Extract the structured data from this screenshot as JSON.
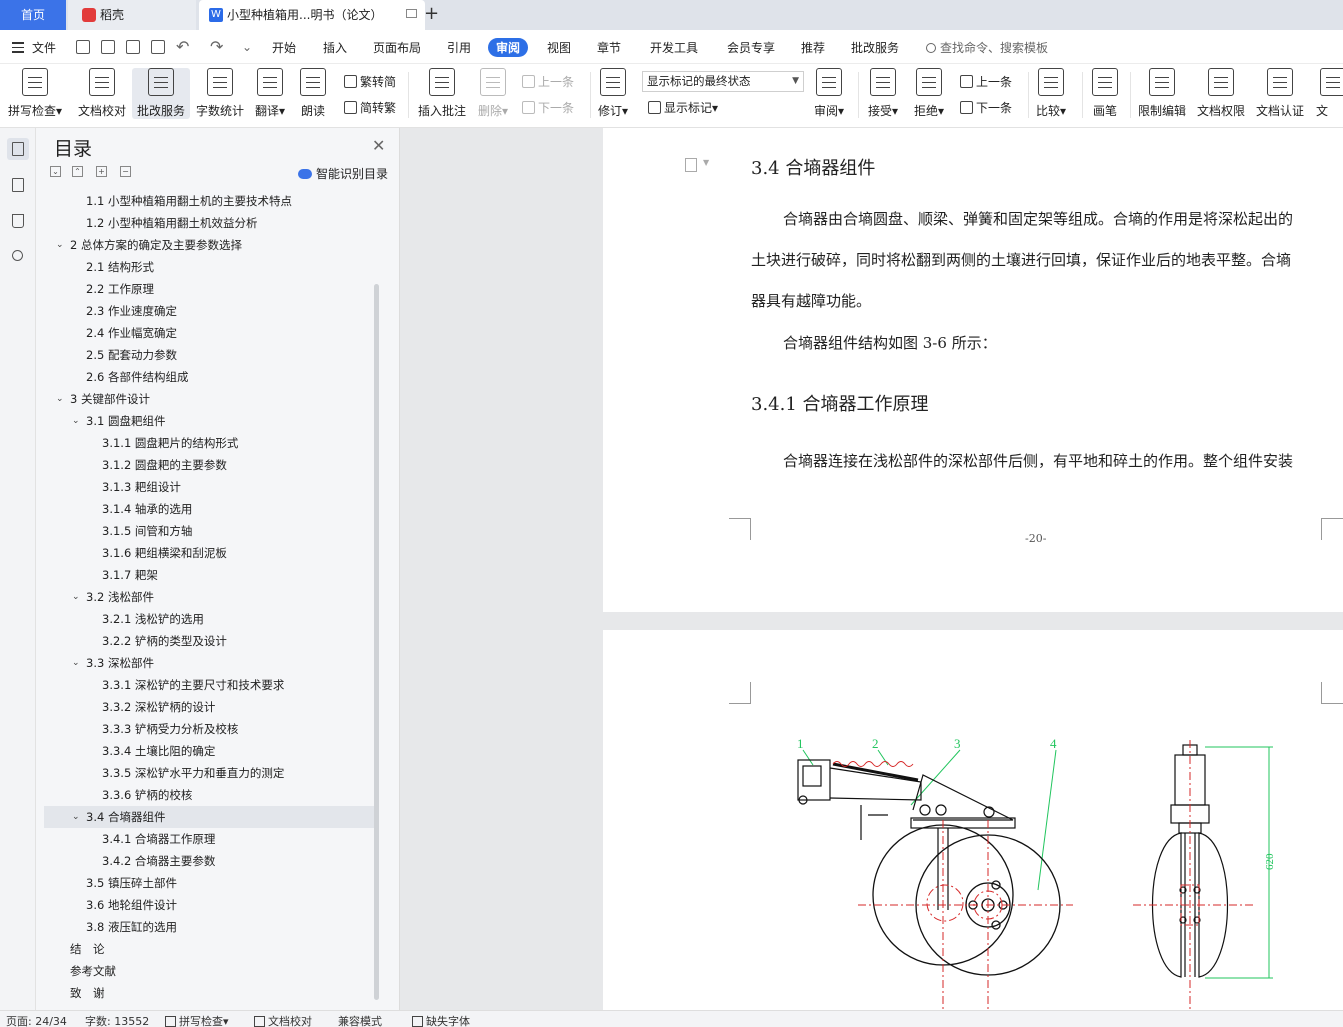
{
  "tabs": {
    "home": "首页",
    "daoke": "稻壳",
    "document": "小型种植箱用...明书（论文）",
    "doc_icon_letter": "W"
  },
  "menu": {
    "file": "文件",
    "items": [
      "开始",
      "插入",
      "页面布局",
      "引用",
      "审阅",
      "视图",
      "章节",
      "开发工具",
      "会员专享",
      "推荐",
      "批改服务"
    ],
    "active": "审阅",
    "search_placeholder": "查找命令、搜索模板"
  },
  "ribbon": {
    "spell_check": "拼写检查",
    "doc_proofread": "文档校对",
    "correction_service": "批改服务",
    "word_count": "字数统计",
    "translate": "翻译",
    "read_aloud": "朗读",
    "trad_to_simp": "繁转简",
    "simp_to_trad": "简转繁",
    "insert_comment": "插入批注",
    "delete": "删除",
    "prev_comment": "上一条",
    "next_comment": "下一条",
    "track_changes": "修订",
    "markup_select": "显示标记的最终状态",
    "show_markup": "显示标记",
    "review": "审阅",
    "accept": "接受",
    "reject": "拒绝",
    "prev_change": "上一条",
    "next_change": "下一条",
    "compare": "比较",
    "pen": "画笔",
    "restrict_edit": "限制编辑",
    "doc_permission": "文档权限",
    "doc_certify": "文档认证",
    "doc_cut": "文"
  },
  "toc": {
    "title": "目录",
    "smart_recognize": "智能识别目录",
    "items": [
      {
        "label": "1.1 小型种植箱用翻土机的主要技术特点",
        "level": 2,
        "expand": "none",
        "selected": false
      },
      {
        "label": "1.2 小型种植箱用翻土机效益分析",
        "level": 2,
        "expand": "none",
        "selected": false
      },
      {
        "label": "2 总体方案的确定及主要参数选择",
        "level": 1,
        "expand": "open",
        "selected": false
      },
      {
        "label": "2.1 结构形式",
        "level": 2,
        "expand": "none",
        "selected": false
      },
      {
        "label": "2.2 工作原理",
        "level": 2,
        "expand": "none",
        "selected": false
      },
      {
        "label": "2.3 作业速度确定",
        "level": 2,
        "expand": "none",
        "selected": false
      },
      {
        "label": "2.4 作业幅宽确定",
        "level": 2,
        "expand": "none",
        "selected": false
      },
      {
        "label": "2.5 配套动力参数",
        "level": 2,
        "expand": "none",
        "selected": false
      },
      {
        "label": "2.6 各部件结构组成",
        "level": 2,
        "expand": "none",
        "selected": false
      },
      {
        "label": "3 关键部件设计",
        "level": 1,
        "expand": "open",
        "selected": false
      },
      {
        "label": "3.1 圆盘耙组件",
        "level": 2,
        "expand": "open",
        "selected": false
      },
      {
        "label": "3.1.1 圆盘耙片的结构形式",
        "level": 3,
        "expand": "none",
        "selected": false
      },
      {
        "label": "3.1.2 圆盘耙的主要参数",
        "level": 3,
        "expand": "none",
        "selected": false
      },
      {
        "label": "3.1.3 耙组设计",
        "level": 3,
        "expand": "none",
        "selected": false
      },
      {
        "label": "3.1.4 轴承的选用",
        "level": 3,
        "expand": "none",
        "selected": false
      },
      {
        "label": "3.1.5 间管和方轴",
        "level": 3,
        "expand": "none",
        "selected": false
      },
      {
        "label": "3.1.6 耙组横梁和刮泥板",
        "level": 3,
        "expand": "none",
        "selected": false
      },
      {
        "label": "3.1.7 耙架",
        "level": 3,
        "expand": "none",
        "selected": false
      },
      {
        "label": "3.2 浅松部件",
        "level": 2,
        "expand": "open",
        "selected": false
      },
      {
        "label": "3.2.1 浅松铲的选用",
        "level": 3,
        "expand": "none",
        "selected": false
      },
      {
        "label": "3.2.2 铲柄的类型及设计",
        "level": 3,
        "expand": "none",
        "selected": false
      },
      {
        "label": "3.3 深松部件",
        "level": 2,
        "expand": "open",
        "selected": false
      },
      {
        "label": "3.3.1 深松铲的主要尺寸和技术要求",
        "level": 3,
        "expand": "none",
        "selected": false
      },
      {
        "label": "3.3.2 深松铲柄的设计",
        "level": 3,
        "expand": "none",
        "selected": false
      },
      {
        "label": "3.3.3 铲柄受力分析及校核",
        "level": 3,
        "expand": "none",
        "selected": false
      },
      {
        "label": "3.3.4 土壤比阻的确定",
        "level": 3,
        "expand": "none",
        "selected": false
      },
      {
        "label": "3.3.5 深松铲水平力和垂直力的测定",
        "level": 3,
        "expand": "none",
        "selected": false
      },
      {
        "label": "3.3.6 铲柄的校核",
        "level": 3,
        "expand": "none",
        "selected": false
      },
      {
        "label": "3.4 合墒器组件",
        "level": 2,
        "expand": "open",
        "selected": true
      },
      {
        "label": "3.4.1 合墒器工作原理",
        "level": 3,
        "expand": "none",
        "selected": false
      },
      {
        "label": "3.4.2 合墒器主要参数",
        "level": 3,
        "expand": "none",
        "selected": false
      },
      {
        "label": "3.5 镇压碎土部件",
        "level": 2,
        "expand": "none",
        "selected": false
      },
      {
        "label": "3.6 地轮组件设计",
        "level": 2,
        "expand": "none",
        "selected": false
      },
      {
        "label": "3.8 液压缸的选用",
        "level": 2,
        "expand": "none",
        "selected": false
      },
      {
        "label": "结　论",
        "level": 1,
        "expand": "none",
        "selected": false
      },
      {
        "label": "参考文献",
        "level": 1,
        "expand": "none",
        "selected": false
      },
      {
        "label": "致　谢",
        "level": 1,
        "expand": "none",
        "selected": false
      }
    ]
  },
  "document": {
    "heading_3_4": "3.4 合墒器组件",
    "para1_line1": "合墒器由合墒圆盘、顺梁、弹簧和固定架等组成。合墒的作用是将深松起出的",
    "para1_line2": "土块进行破碎，同时将松翻到两侧的土壤进行回填，保证作业后的地表平整。合墒",
    "para1_line3": "器具有越障功能。",
    "para2": "合墒器组件结构如图 3-6 所示：",
    "heading_3_4_1": "3.4.1 合墒器工作原理",
    "para3": "合墒器连接在浅松部件的深松部件后侧，有平地和碎土的作用。整个组件安装",
    "page_number": "-20-",
    "figure_labels": [
      "1",
      "2",
      "3",
      "4"
    ],
    "figure_dimension": "620"
  },
  "status": {
    "page": "页面: 24/34",
    "words": "字数: 13552",
    "spell_check": "拼写检查",
    "proofread": "文档校对",
    "compat_mode": "兼容模式",
    "missing_font": "缺失字体"
  },
  "colors": {
    "accent": "#2d6fe6",
    "home_tab": "#3b73e8",
    "cad_green": "#22c55e",
    "cad_red": "#d62828"
  }
}
